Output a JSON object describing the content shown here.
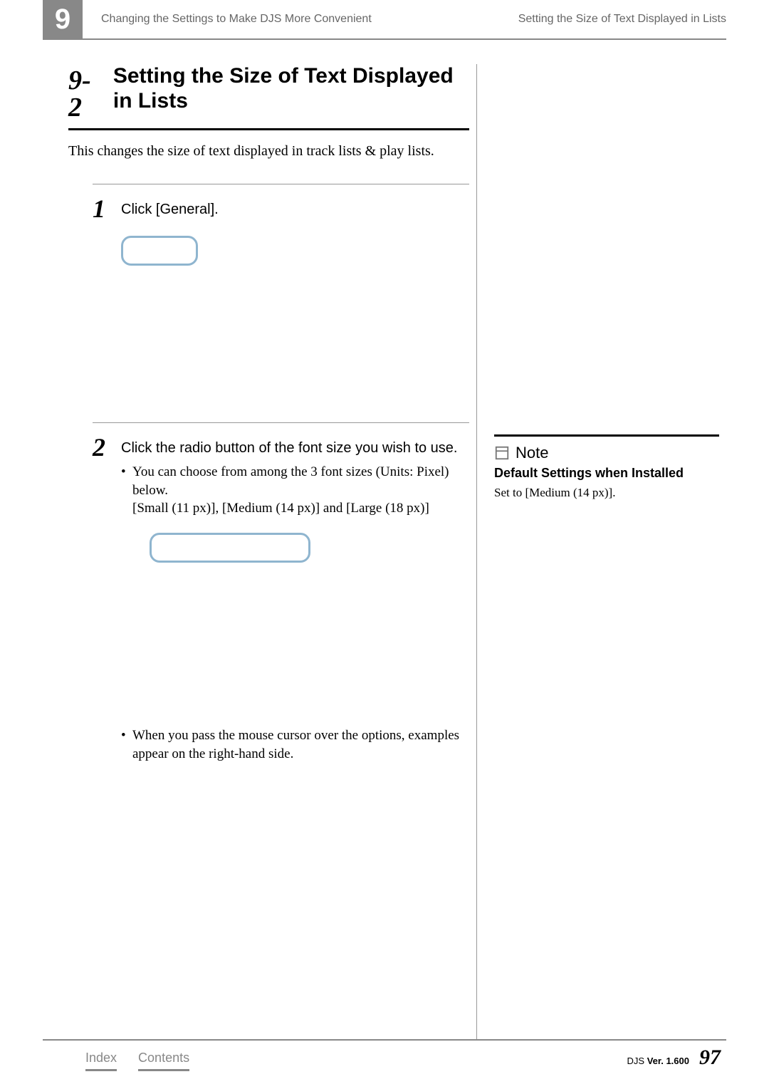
{
  "header": {
    "chapter_number": "9",
    "breadcrumb_left": "Changing the Settings to Make DJS More Convenient",
    "breadcrumb_right": "Setting the Size of Text Displayed in Lists"
  },
  "section": {
    "number": "9-2",
    "title": "Setting the Size of Text Displayed in Lists",
    "intro": "This changes the size of text displayed in track lists & play lists."
  },
  "steps": [
    {
      "num": "1",
      "title": "Click [General].",
      "bullets": []
    },
    {
      "num": "2",
      "title": "Click the radio button of the font size you wish to use.",
      "bullets": [
        "You can choose from among the 3 font sizes (Units: Pixel) below.",
        "[Small (11 px)], [Medium (14 px)] and [Large (18 px)]",
        "When you pass the mouse cursor over the options, examples appear on the right-hand side."
      ]
    }
  ],
  "note": {
    "heading": "Note",
    "subheading": "Default Settings when Installed",
    "body": "Set to [Medium (14 px)]."
  },
  "footer": {
    "index": "Index",
    "contents": "Contents",
    "product": "DJS",
    "ver_label": "Ver.",
    "version": "1.600",
    "page": "97"
  }
}
